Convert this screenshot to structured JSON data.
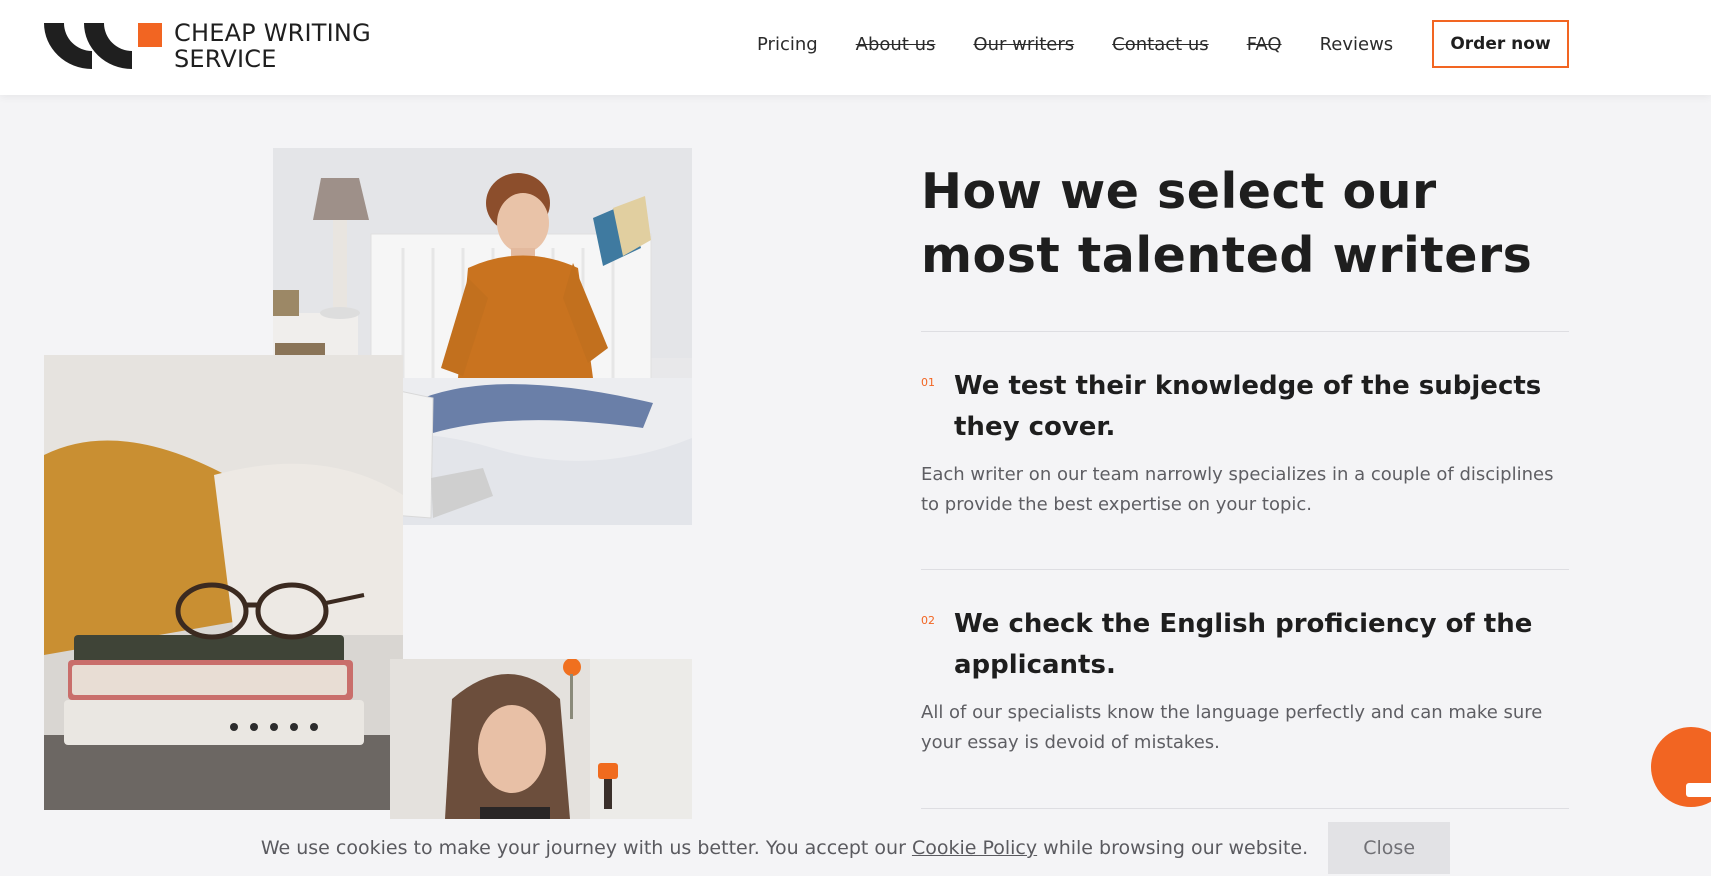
{
  "logo": {
    "line1": "CHEAP WRITING",
    "line2": "SERVICE"
  },
  "nav": {
    "items": [
      {
        "label": "Pricing",
        "strike": false
      },
      {
        "label": "About us",
        "strike": true
      },
      {
        "label": "Our writers",
        "strike": true
      },
      {
        "label": "Contact us",
        "strike": true
      },
      {
        "label": "FAQ",
        "strike": true
      },
      {
        "label": "Reviews",
        "strike": false
      }
    ],
    "order_button": "Order now"
  },
  "main": {
    "headline": "How we select our most talented writers",
    "items": [
      {
        "num": "01",
        "title": "We test their knowledge of the subjects they cover.",
        "desc": "Each writer on our team narrowly specializes in a couple of disciplines to provide the best expertise on your topic."
      },
      {
        "num": "02",
        "title": "We check the English proficiency of the applicants.",
        "desc": "All of our specialists know the language perfectly and can make sure your essay is devoid of mistakes."
      }
    ]
  },
  "cookie": {
    "text_before": "We use cookies to make your journey with us better. You accept our ",
    "link": "Cookie Policy",
    "text_after": " while browsing our website.",
    "close": "Close"
  },
  "colors": {
    "accent": "#f26522",
    "text": "#1e1e1e",
    "muted": "#5e5e63",
    "background": "#f4f4f6"
  },
  "icons": {
    "logo": "brand-logo-mark",
    "chat": "chat-bubble-icon"
  }
}
